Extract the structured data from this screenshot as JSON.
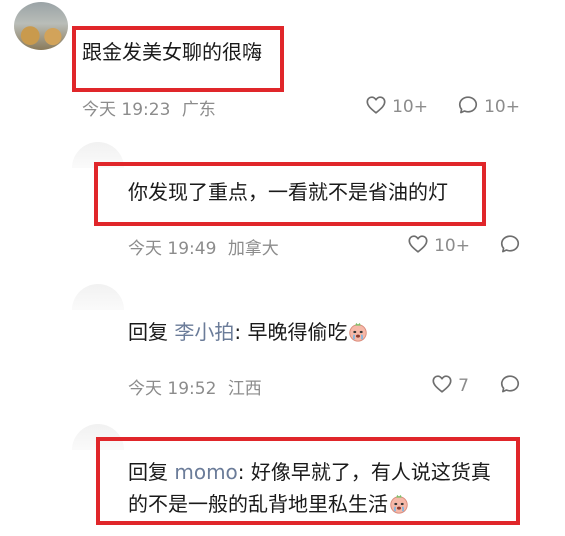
{
  "comments": [
    {
      "text": "跟金发美女聊的很嗨",
      "time": "今天 19:23",
      "location": "广东",
      "likes": "10+",
      "replies": "10+"
    },
    {
      "text": "你发现了重点，一看就不是省油的灯",
      "time": "今天 19:49",
      "location": "加拿大",
      "likes": "10+"
    },
    {
      "reply_prefix": "回复",
      "reply_to": "李小拍",
      "text": ": 早晚得偷吃",
      "time": "今天 19:52",
      "location": "江西",
      "likes": "7"
    },
    {
      "reply_prefix": "回复",
      "reply_to": "momo",
      "text_line1": ": 好像早就了，有人说这货真",
      "text_line2": "的不是一般的乱背地里私生活"
    }
  ],
  "colors": {
    "highlight": "#e0262a",
    "meta": "#8c8c8c",
    "reply_name": "#6b7c99"
  },
  "icons": [
    "heart-icon",
    "comment-icon",
    "crying-face-emoji"
  ]
}
